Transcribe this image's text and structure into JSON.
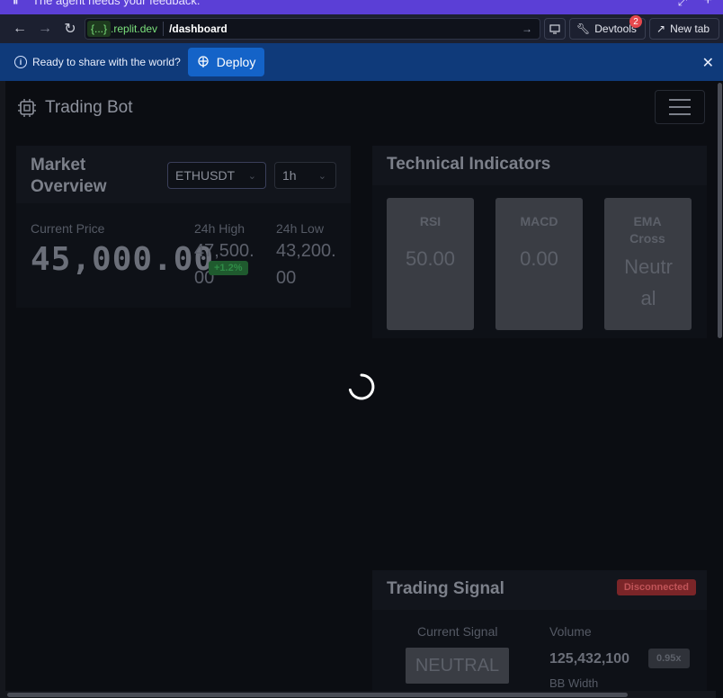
{
  "topstrip": {
    "text": "The agent needs your feedback."
  },
  "browser": {
    "domain_pill": "{...}",
    "domain_rest": ".replit.dev",
    "path": "/dashboard",
    "devtools_label": "Devtools",
    "devtools_badge": "2",
    "newtab_label": "New tab"
  },
  "banner": {
    "message": "Ready to share with the world?",
    "deploy_label": "Deploy"
  },
  "app": {
    "brand": "Trading Bot"
  },
  "market": {
    "title": "Market Overview",
    "symbol": "ETHUSDT",
    "interval": "1h",
    "current_price_label": "Current Price",
    "current_price": "45,000.00",
    "high_label": "24h High",
    "high_value": "47,500.00",
    "low_label": "24h Low",
    "low_value": "43,200.00",
    "change": "+1.2%",
    "change_color": "#1f5a2e"
  },
  "indicators": {
    "title": "Technical Indicators",
    "items": [
      {
        "name": "RSI",
        "value": "50.00"
      },
      {
        "name": "MACD",
        "value": "0.00"
      },
      {
        "name": "EMA Cross",
        "value": "Neutral"
      }
    ]
  },
  "signal": {
    "title": "Trading Signal",
    "status": "Disconnected",
    "status_color": "#7a2528",
    "current_signal_label": "Current Signal",
    "current_signal": "NEUTRAL",
    "volume_label": "Volume",
    "volume_value": "125,432,100",
    "volume_ratio": "0.95x",
    "bb_width_label": "BB Width"
  }
}
